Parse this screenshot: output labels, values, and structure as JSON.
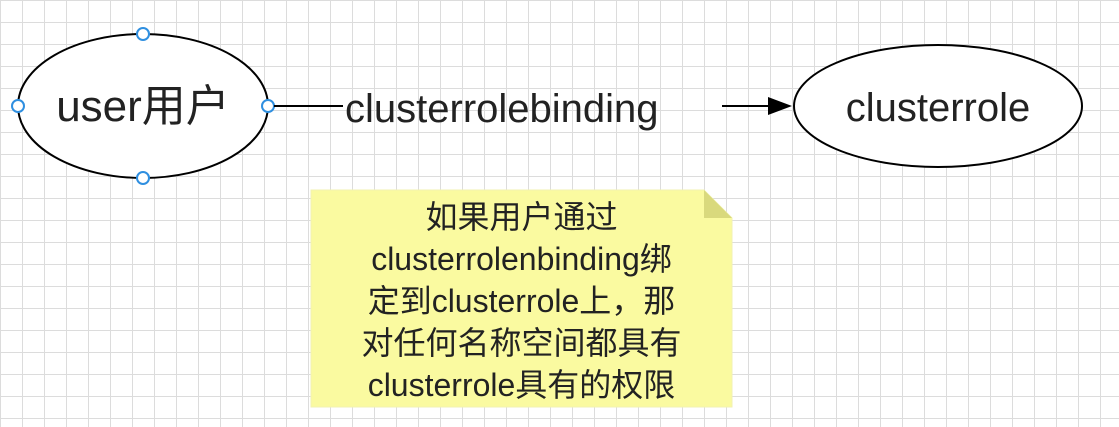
{
  "nodes": {
    "user": {
      "label": "user用户",
      "shape": "ellipse",
      "selected": true
    },
    "cluster_role": {
      "label": "clusterrole",
      "shape": "ellipse"
    }
  },
  "edge": {
    "label": "clusterrolebinding",
    "from": "user",
    "to": "cluster_role",
    "arrow": "filled-triangle"
  },
  "note": {
    "lines": [
      "如果用户通过",
      "clusterrolenbinding绑",
      "定到clusterrole上，那",
      "对任何名称空间都具有",
      "clusterrole具有的权限"
    ]
  },
  "colors": {
    "note_fill": "#fafaa0",
    "note_fold": "#d9d97d",
    "selection_handle": "#2f8fe0",
    "stroke": "#000000",
    "grid": "#dcdcdc"
  }
}
